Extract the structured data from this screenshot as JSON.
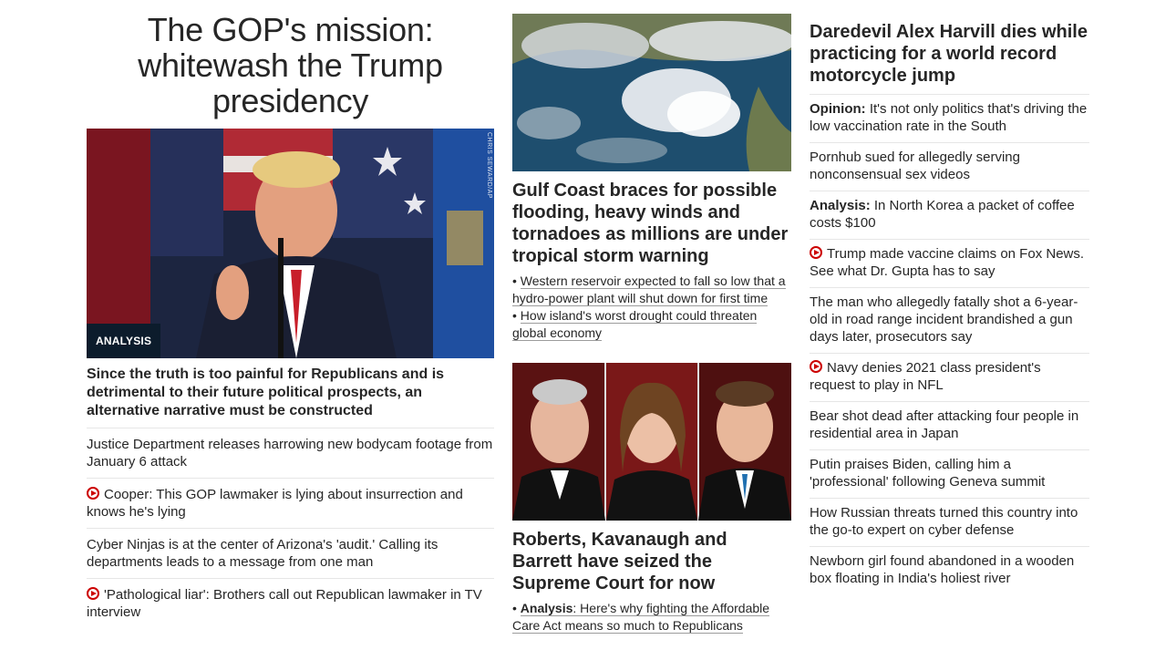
{
  "left": {
    "headline": "The GOP's mission: whitewash the Trump presidency",
    "image_badge": "ANALYSIS",
    "image_credit": "CHRIS SEWARD/AP",
    "dek": "Since the truth is too painful for Republicans and is detrimental to their future political prospects, an alternative narrative must be constructed",
    "items": [
      {
        "text": "Justice Department releases harrowing new bodycam footage from January 6 attack",
        "video": false
      },
      {
        "text": "Cooper: This GOP lawmaker is lying about insurrection and knows he's lying",
        "video": true
      },
      {
        "text": "Cyber Ninjas is at the center of Arizona's 'audit.' Calling its departments leads to a message from one man",
        "video": false
      },
      {
        "text": "'Pathological liar': Brothers call out Republican lawmaker in TV interview",
        "video": true
      }
    ]
  },
  "middle": {
    "story1": {
      "headline": "Gulf Coast braces for possible flooding, heavy winds and tornadoes as millions are under tropical storm warning",
      "bullets": [
        "Western reservoir expected to fall so low that a hydro-power plant will shut down for first time",
        "How island's worst drought could threaten global economy"
      ]
    },
    "story2": {
      "headline": "Roberts, Kavanaugh and Barrett have seized the Supreme Court for now",
      "bullet_label": "Analysis",
      "bullet_text": ": Here's why fighting the Affordable Care Act means so much to Republicans"
    }
  },
  "right": {
    "headline": "Daredevil Alex Harvill dies while practicing for a world record motorcycle jump",
    "items": [
      {
        "label": "Opinion:",
        "text": " It's not only politics that's driving the low vaccination rate in the South",
        "video": false
      },
      {
        "label": "",
        "text": "Pornhub sued for allegedly serving nonconsensual sex videos",
        "video": false
      },
      {
        "label": "Analysis:",
        "text": " In North Korea a packet of coffee costs $100",
        "video": false
      },
      {
        "label": "",
        "text": "Trump made vaccine claims on Fox News. See what Dr. Gupta has to say",
        "video": true
      },
      {
        "label": "",
        "text": "The man who allegedly fatally shot a 6-year-old in road range incident brandished a gun days later, prosecutors say",
        "video": false
      },
      {
        "label": "",
        "text": "Navy denies 2021 class president's request to play in NFL",
        "video": true
      },
      {
        "label": "",
        "text": "Bear shot dead after attacking four people in residential area in Japan",
        "video": false
      },
      {
        "label": "",
        "text": "Putin praises Biden, calling him a 'professional' following Geneva summit",
        "video": false
      },
      {
        "label": "",
        "text": "How Russian threats turned this country into the go-to expert on cyber defense",
        "video": false
      },
      {
        "label": "",
        "text": "Newborn girl found abandoned in a wooden box floating in India's holiest river",
        "video": false
      }
    ]
  },
  "colors": {
    "video_red": "#cc0000",
    "badge_bg": "#0c1c2c",
    "text": "#262626",
    "divider": "#e6e6e6"
  }
}
